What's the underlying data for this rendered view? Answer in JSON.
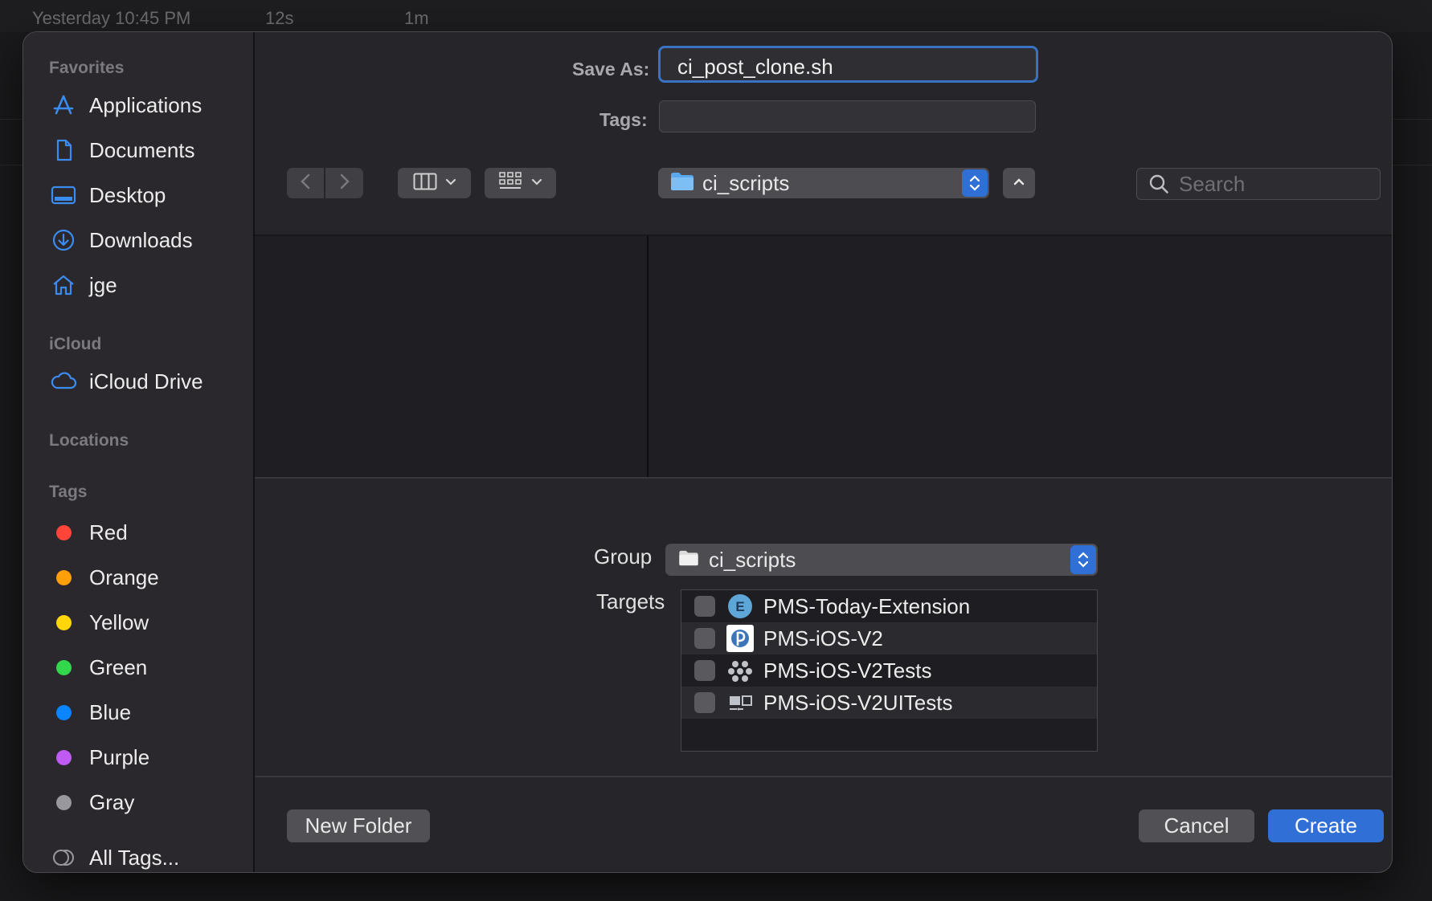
{
  "background": {
    "timestamp": "Yesterday 10:45 PM",
    "col2": "12s",
    "col3": "1m"
  },
  "sidebar": {
    "favorites_header": "Favorites",
    "favorites": [
      {
        "label": "Applications",
        "icon": "applications-icon"
      },
      {
        "label": "Documents",
        "icon": "document-icon"
      },
      {
        "label": "Desktop",
        "icon": "desktop-icon"
      },
      {
        "label": "Downloads",
        "icon": "downloads-icon"
      },
      {
        "label": "jge",
        "icon": "home-icon"
      }
    ],
    "icloud_header": "iCloud",
    "icloud": [
      {
        "label": "iCloud Drive",
        "icon": "cloud-icon"
      }
    ],
    "locations_header": "Locations",
    "tags_header": "Tags",
    "tags": [
      {
        "label": "Red",
        "color": "#ff453a"
      },
      {
        "label": "Orange",
        "color": "#ff9f0a"
      },
      {
        "label": "Yellow",
        "color": "#ffd60a"
      },
      {
        "label": "Green",
        "color": "#32d74b"
      },
      {
        "label": "Blue",
        "color": "#0a84ff"
      },
      {
        "label": "Purple",
        "color": "#bf5af2"
      },
      {
        "label": "Gray",
        "color": "#98989d"
      }
    ],
    "all_tags": "All Tags..."
  },
  "form": {
    "save_as_label": "Save As:",
    "save_as_value": "ci_post_clone.sh",
    "tags_label": "Tags:",
    "tags_value": ""
  },
  "toolbar": {
    "location": "ci_scripts",
    "search_placeholder": "Search"
  },
  "options": {
    "group_label": "Group",
    "group_value": "ci_scripts",
    "targets_label": "Targets",
    "targets": [
      {
        "label": "PMS-Today-Extension",
        "icon": "extension-icon",
        "checked": false
      },
      {
        "label": "PMS-iOS-V2",
        "icon": "app-icon",
        "checked": false
      },
      {
        "label": "PMS-iOS-V2Tests",
        "icon": "unit-tests-icon",
        "checked": false
      },
      {
        "label": "PMS-iOS-V2UITests",
        "icon": "ui-tests-icon",
        "checked": false
      }
    ]
  },
  "buttons": {
    "new_folder": "New Folder",
    "cancel": "Cancel",
    "create": "Create"
  },
  "colors": {
    "accent": "#2f6fd6",
    "focus_ring": "#3a73c4",
    "folder": "#5aa8f0"
  }
}
